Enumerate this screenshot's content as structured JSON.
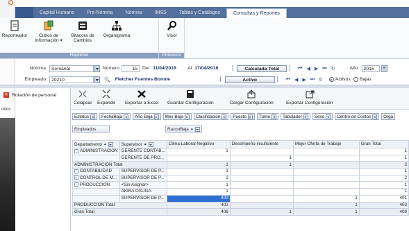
{
  "left_window": {
    "item_label": "otros"
  },
  "ribbon": {
    "tabs": [
      "",
      "Capital Humano",
      "Pre-Nómina",
      "Nómina",
      "IMSS",
      "Tablas y Catálogos",
      "Consultas y Reportes"
    ],
    "active_tab": "Consultas y Reportes",
    "groups": [
      {
        "label": "Reportes",
        "buttons": [
          "Reporteador",
          "Cubos de Información ▾",
          "Bitácora de Cambios",
          "Organigrama"
        ]
      },
      {
        "label": "Procesos",
        "buttons": [
          "Visor"
        ]
      }
    ]
  },
  "filters": {
    "nomina_label": "Nómina",
    "nomina_value": "Semanal",
    "numero_label": "Número",
    "numero_value": "15",
    "del_label": "Del",
    "del_value": "11/04/2016",
    "al_label": "Al",
    "al_value": "17/04/2016",
    "status_nomina": "Calculada Total",
    "anio_label": "Año",
    "anio_value": "2016",
    "empleado_label": "Empleado",
    "empleado_id": "20210",
    "empleado_name": "Fletcher Fuentes Bonnie",
    "status_empleado": "Activo",
    "radio_activos": "Activos",
    "radio_bajas": "Bajas"
  },
  "sidebar": {
    "items": [
      "Rotación de personal"
    ]
  },
  "toolbar": {
    "buttons": [
      "Colapsar",
      "Expandir",
      "Exportar a Excel",
      "Guardar Configuración",
      "Cargar Configuración",
      "Exportar Configuración"
    ]
  },
  "pivot": {
    "filter_fields": [
      "Estatus",
      "FechaBaja",
      "Año Baja",
      "Mes Baja",
      "Clasificacion",
      "Puesto",
      "Turno",
      "Tabulador",
      "Sexo",
      "Centro de Costos",
      "Orga"
    ],
    "data_field": "Empleados",
    "column_field": "RazonBaja",
    "row_fields": [
      "Departamento",
      "Supervisor"
    ],
    "columns": [
      "Clima Laboral Negativo",
      "Desempeño insuficiente",
      "Mejor Oferta de Trabajo",
      "Gran Total"
    ],
    "rows": [
      {
        "dept": "ADMINISTRACION",
        "sup": "GERENTE CONTAB...",
        "vals": [
          "1",
          "",
          "",
          "1"
        ]
      },
      {
        "dept": "",
        "sup": "GERENTE DE PRO...",
        "vals": [
          "",
          "1",
          "",
          "1"
        ]
      },
      {
        "dept": "ADMINISTRACION Total",
        "sup": "",
        "vals": [
          "1",
          "1",
          "",
          "2"
        ],
        "total": true
      },
      {
        "dept": "CONTABILIDAD",
        "sup": "SUPERVISOR DE P...",
        "vals": [
          "1",
          "",
          "",
          "1"
        ]
      },
      {
        "dept": "CONTROL DE M...",
        "sup": "SUPERVISOR DE P...",
        "vals": [
          "2",
          "",
          "",
          "2"
        ]
      },
      {
        "dept": "PRODUCCION",
        "sup": "<Sin Asignar>",
        "vals": [
          "1",
          "",
          "",
          "1"
        ]
      },
      {
        "dept": "",
        "sup": "AKIRA OSUGA",
        "vals": [
          "1",
          "",
          "",
          "1"
        ]
      },
      {
        "dept": "",
        "sup": "SUPERVISOR DE P...",
        "vals": [
          "400",
          "",
          "1",
          "401"
        ],
        "selected": true
      },
      {
        "dept": "PRODUCCION Total",
        "sup": "",
        "vals": [
          "402",
          "",
          "1",
          "403"
        ],
        "total": true
      },
      {
        "dept": "Gran Total",
        "sup": "",
        "vals": [
          "406",
          "1",
          "1",
          "408"
        ],
        "total": true
      }
    ]
  },
  "colors": {
    "ribbon_tab_bar": "#54709c",
    "selection": "#2f6fd0",
    "close_red": "#d43b2f"
  }
}
